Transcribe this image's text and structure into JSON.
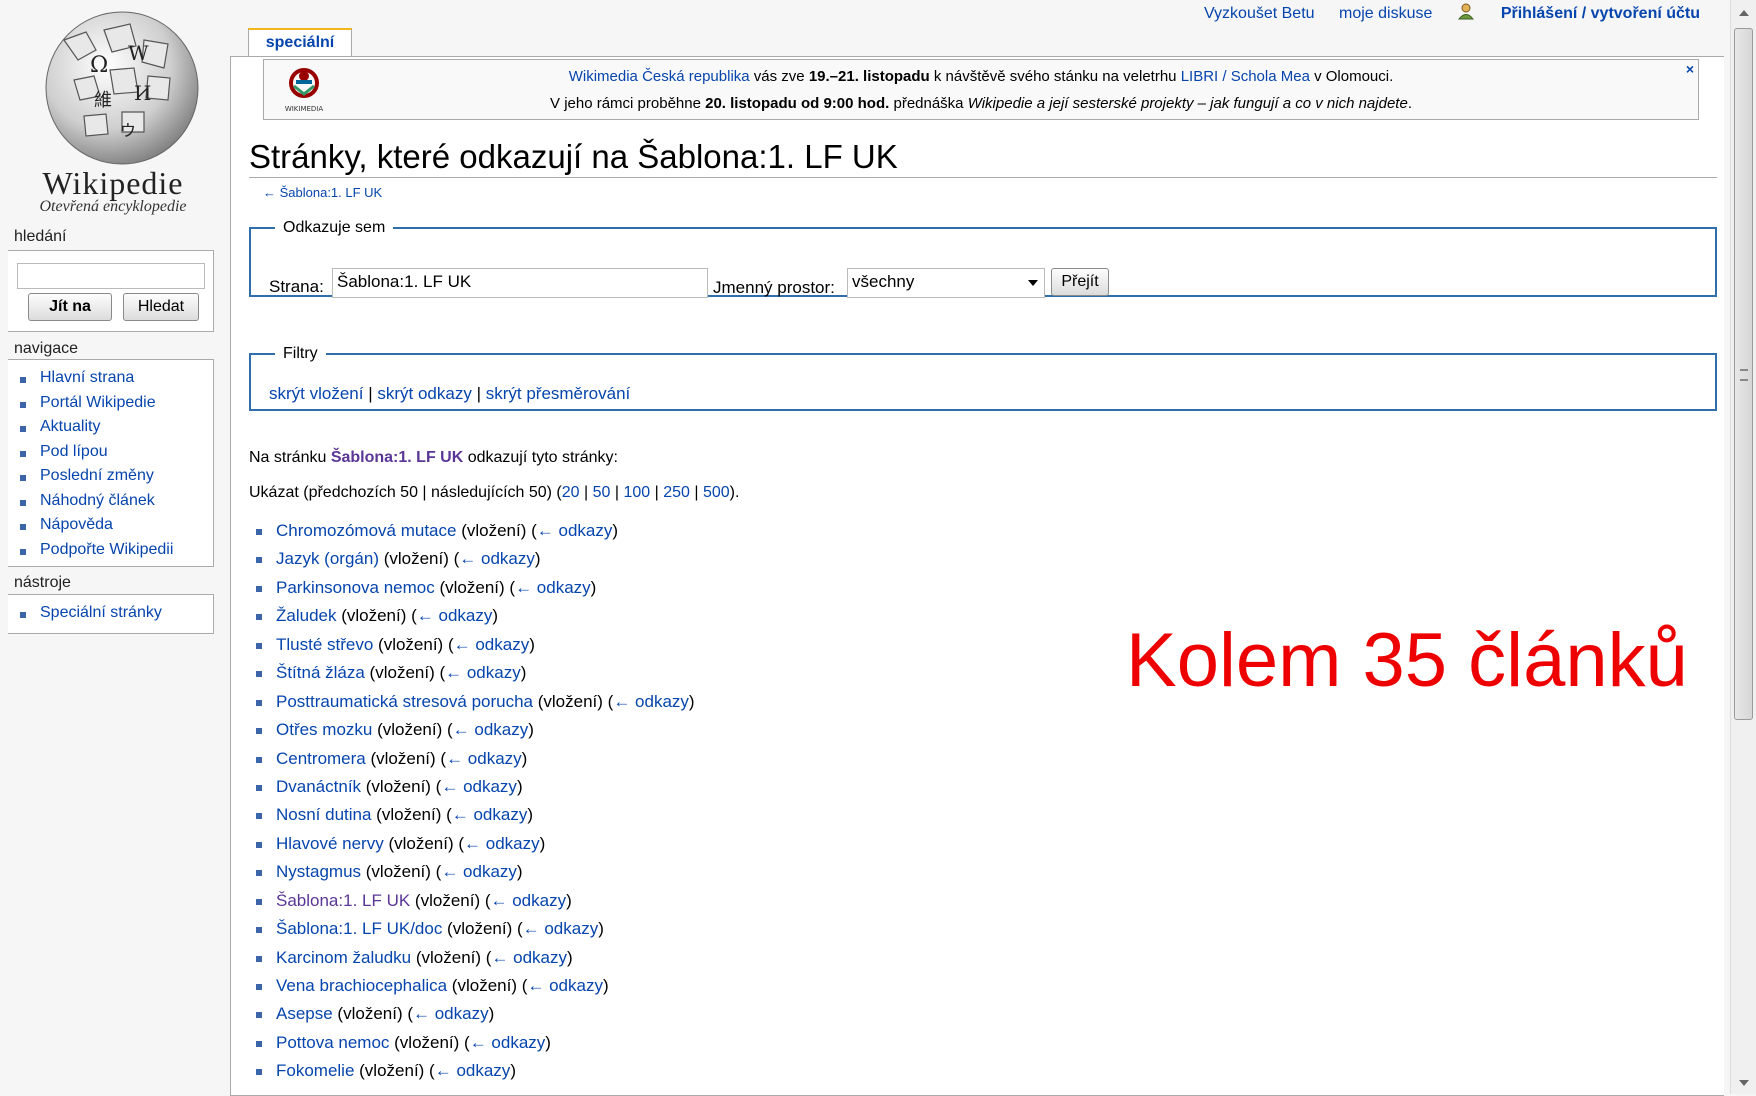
{
  "logo": {
    "wordmark": "Wikipedie",
    "tagline": "Otevřená encyklopedie"
  },
  "personal": {
    "try_beta": "Vyzkoušet Betu",
    "discussion": "moje diskuse",
    "login": "Přihlášení / vytvoření účtu"
  },
  "tab": {
    "label": "speciální"
  },
  "notice": {
    "l1_a": "Wikimedia Česká republika",
    "l1_b": " vás zve ",
    "l1_c": "19.–21. listopadu",
    "l1_d": " k návštěvě svého stánku na veletrhu ",
    "l1_e": "LIBRI / Schola Mea",
    "l1_f": " v Olomouci.",
    "l2_a": "V jeho rámci proběhne ",
    "l2_b": "20. listopadu od 9:00 hod.",
    "l2_c": " přednáška ",
    "l2_d": "Wikipedie a její sesterské projekty – jak fungují a co v nich najdete",
    "l2_e": ".",
    "close": "×",
    "logo_caption": "WIKIMEDIA"
  },
  "sidebar": {
    "search_heading": "hledání",
    "go_button": "Jít na",
    "search_button": "Hledat",
    "nav_heading": "navigace",
    "nav_items": [
      "Hlavní strana",
      "Portál Wikipedie",
      "Aktuality",
      "Pod lípou",
      "Poslední změny",
      "Náhodný článek",
      "Nápověda",
      "Podpořte Wikipedii"
    ],
    "tools_heading": "nástroje",
    "tools_items": [
      "Speciální stránky"
    ]
  },
  "page": {
    "title": "Stránky, které odkazují na Šablona:1. LF UK",
    "backlink": "← Šablona:1. LF UK"
  },
  "form": {
    "legend": "Odkazuje sem",
    "page_label": "Strana:",
    "page_value": "Šablona:1. LF UK",
    "ns_label": "Jmenný prostor:",
    "ns_value": "všechny",
    "submit": "Přejít"
  },
  "filters": {
    "legend": "Filtry",
    "hide_transclusions": "skrýt vložení",
    "hide_links": "skrýt odkazy",
    "hide_redirects": "skrýt přesměrování",
    "sep": " | "
  },
  "intro": {
    "prefix": "Na stránku ",
    "target": "Šablona:1. LF UK",
    "suffix": " odkazují tyto stránky:"
  },
  "paging": {
    "prefix": "Ukázat (předchozích 50 | následujících 50) (",
    "limits": [
      "20",
      "50",
      "100",
      "250",
      "500"
    ],
    "suffix": ")."
  },
  "list_strings": {
    "transclusion": " (vložení) (",
    "links": "← odkazy",
    "close": ")"
  },
  "results": [
    "Chromozómová mutace",
    "Jazyk (orgán)",
    "Parkinsonova nemoc",
    "Žaludek",
    "Tlusté střevo",
    "Štítná žláza",
    "Posttraumatická stresová porucha",
    "Otřes mozku",
    "Centromera",
    "Dvanáctník",
    "Nosní dutina",
    "Hlavové nervy",
    "Nystagmus",
    "Šablona:1. LF UK",
    "Šablona:1. LF UK/doc",
    "Karcinom žaludku",
    "Vena brachiocephalica",
    "Asepse",
    "Pottova nemoc",
    "Fokomelie"
  ],
  "visited_results": [
    13
  ],
  "overlay": {
    "text": "Kolem 35 článků"
  },
  "colors": {
    "link": "#0645ad",
    "visited": "#5a3696",
    "overlay": "#ee0000",
    "fieldset_border": "#2f6fab",
    "tab_accent": "#f3b61a"
  }
}
